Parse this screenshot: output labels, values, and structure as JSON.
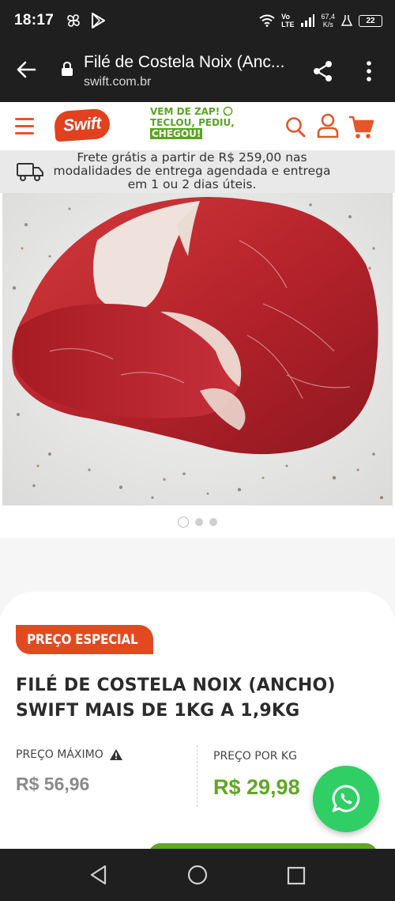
{
  "status_bar": {
    "time": "18:17",
    "network_label": "Vo\nLTE",
    "net_speed_value": "67,4",
    "net_speed_unit": "K/s",
    "battery": "22"
  },
  "browser": {
    "page_title": "Filé de Costela Noix (Anc...",
    "url": "swift.com.br"
  },
  "header": {
    "logo_text": "Swift",
    "zap_promo": {
      "line1": "VEM DE ZAP!",
      "line2": "TECLOU, PEDIU,",
      "line3": "CHEGOU!"
    }
  },
  "shipping_banner": {
    "text": "Frete grátis a partir de R$ 259,00 nas modalidades de entrega agendada e entrega em 1 ou 2 dias úteis."
  },
  "carousel": {
    "total": 3,
    "active_index": 0
  },
  "product": {
    "badge": "PREÇO ESPECIAL",
    "name": "FILÉ DE COSTELA NOIX (ANCHO) SWIFT MAIS DE 1KG A 1,9KG",
    "price_max_label": "PREÇO MÁXIMO",
    "price_max_value": "R$ 56,96",
    "price_per_kg_label": "PREÇO POR KG",
    "price_per_kg_value": "R$ 29,98"
  },
  "colors": {
    "brand_orange": "#e14a21",
    "brand_green": "#5fa726",
    "whatsapp_green": "#2fcf66"
  },
  "icons": [
    "back-arrow-icon",
    "lock-icon",
    "share-icon",
    "more-vert-icon",
    "menu-icon",
    "search-icon",
    "user-icon",
    "cart-icon",
    "truck-icon",
    "warning-icon",
    "whatsapp-icon"
  ]
}
